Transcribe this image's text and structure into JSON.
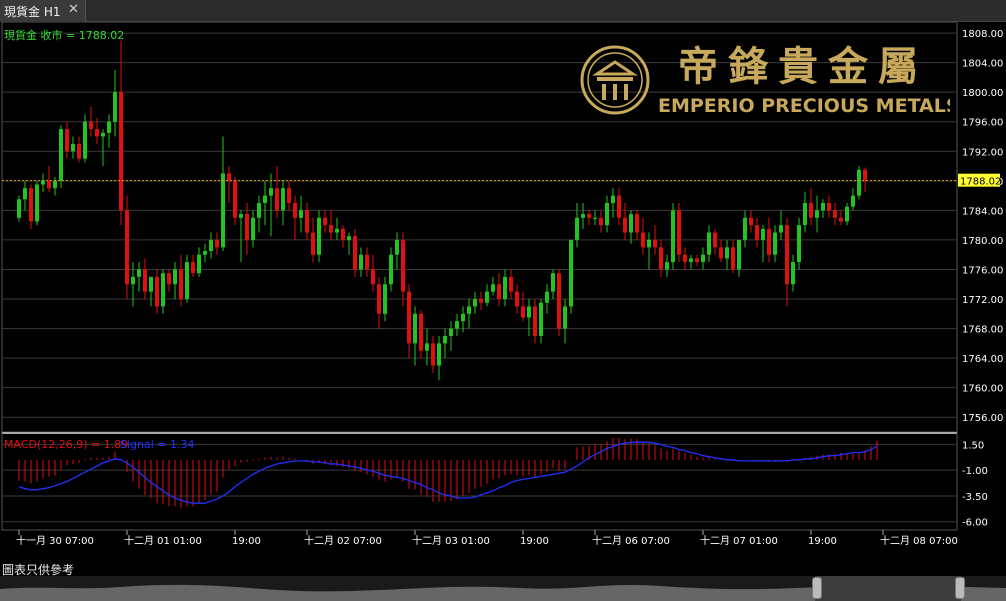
{
  "window": {
    "tab_title": "現貨金 H1",
    "close_glyph": "✕"
  },
  "logo": {
    "chinese_name": "帝鋒貴金屬",
    "english_name": "EMPERIO PRECIOUS METALS",
    "icon": "emperio-emblem-icon",
    "gold_color": "#c8a85a"
  },
  "footer_note": "圖表只供參考",
  "colors": {
    "bull": "#22c422",
    "bear": "#e01010",
    "grid": "#3a3a3a",
    "axis_text": "#ffffff",
    "price_line": "#e8a020",
    "price_label_bg": "#ffff33",
    "legend_main": "#33dd33",
    "macd_hist": "#e01010",
    "macd_signal": "#2030ff",
    "macd_label": "#e01010"
  },
  "chart_data": [
    {
      "type": "candlestick",
      "legend": "現貨金 收市 = 1788.02",
      "current_price": 1788.02,
      "current_price_label": "1788.02",
      "ylim": [
        1754,
        1809.5
      ],
      "y_ticks": [
        1808.0,
        1804.0,
        1800.0,
        1796.0,
        1792.0,
        1788.0,
        1784.0,
        1780.0,
        1776.0,
        1772.0,
        1768.0,
        1764.0,
        1760.0,
        1756.0
      ],
      "y_tick_labels": [
        "1808.00",
        "1804.00",
        "1800.00",
        "1796.00",
        "1792.00",
        "1788.00",
        "1784.00",
        "1780.00",
        "1776.00",
        "1772.00",
        "1768.00",
        "1764.00",
        "1760.00",
        "1756.00"
      ],
      "x_labels": [
        {
          "label": "十一月 30 07:00",
          "index": 0
        },
        {
          "label": "十二月 01 01:00",
          "index": 18
        },
        {
          "label": "19:00",
          "index": 36
        },
        {
          "label": "十二月 02 07:00",
          "index": 48
        },
        {
          "label": "十二月 03 01:00",
          "index": 66
        },
        {
          "label": "19:00",
          "index": 84
        },
        {
          "label": "十二月 06 07:00",
          "index": 96
        },
        {
          "label": "十二月 07 01:00",
          "index": 114
        },
        {
          "label": "19:00",
          "index": 132
        },
        {
          "label": "十二月 08 07:00",
          "index": 144
        }
      ],
      "ohlc": [
        [
          1783.0,
          1786.0,
          1782.5,
          1785.5
        ],
        [
          1785.5,
          1788.0,
          1784.0,
          1787.0
        ],
        [
          1787.0,
          1787.5,
          1781.5,
          1782.5
        ],
        [
          1782.5,
          1788.0,
          1782.0,
          1787.5
        ],
        [
          1787.5,
          1789.0,
          1786.5,
          1788.0
        ],
        [
          1788.0,
          1790.0,
          1786.5,
          1787.0
        ],
        [
          1787.0,
          1788.5,
          1786.0,
          1788.0
        ],
        [
          1788.0,
          1795.5,
          1787.0,
          1795.0
        ],
        [
          1795.0,
          1796.0,
          1791.0,
          1792.0
        ],
        [
          1792.0,
          1794.0,
          1791.0,
          1793.0
        ],
        [
          1793.0,
          1794.0,
          1790.5,
          1791.0
        ],
        [
          1791.0,
          1797.0,
          1790.5,
          1796.0
        ],
        [
          1796.0,
          1798.0,
          1794.0,
          1795.0
        ],
        [
          1795.0,
          1796.5,
          1793.0,
          1794.0
        ],
        [
          1794.0,
          1795.0,
          1790.0,
          1794.5
        ],
        [
          1794.5,
          1797.0,
          1792.5,
          1796.0
        ],
        [
          1796.0,
          1803.0,
          1794.0,
          1800.0
        ],
        [
          1800.0,
          1807.0,
          1782.0,
          1784.0
        ],
        [
          1784.0,
          1786.0,
          1772.0,
          1774.0
        ],
        [
          1774.0,
          1777.0,
          1771.0,
          1775.0
        ],
        [
          1775.0,
          1777.0,
          1773.0,
          1776.0
        ],
        [
          1776.0,
          1777.5,
          1772.0,
          1773.0
        ],
        [
          1773.0,
          1775.0,
          1771.0,
          1775.0
        ],
        [
          1775.0,
          1776.0,
          1770.0,
          1771.0
        ],
        [
          1771.0,
          1776.0,
          1770.0,
          1775.5
        ],
        [
          1775.5,
          1776.0,
          1773.0,
          1774.0
        ],
        [
          1774.0,
          1777.0,
          1772.0,
          1776.0
        ],
        [
          1776.0,
          1778.0,
          1771.0,
          1772.0
        ],
        [
          1772.0,
          1778.0,
          1771.5,
          1777.0
        ],
        [
          1777.0,
          1778.0,
          1775.0,
          1775.5
        ],
        [
          1775.5,
          1779.0,
          1775.0,
          1778.0
        ],
        [
          1778.0,
          1779.5,
          1777.0,
          1778.5
        ],
        [
          1778.5,
          1781.0,
          1777.5,
          1780.0
        ],
        [
          1780.0,
          1781.0,
          1778.0,
          1779.0
        ],
        [
          1779.0,
          1794.0,
          1778.5,
          1789.0
        ],
        [
          1789.0,
          1790.0,
          1785.0,
          1788.0
        ],
        [
          1788.0,
          1788.5,
          1782.0,
          1783.0
        ],
        [
          1783.0,
          1784.0,
          1777.0,
          1783.5
        ],
        [
          1783.5,
          1785.0,
          1778.0,
          1780.0
        ],
        [
          1780.0,
          1784.0,
          1779.0,
          1783.0
        ],
        [
          1783.0,
          1786.0,
          1781.0,
          1785.0
        ],
        [
          1785.0,
          1788.0,
          1782.0,
          1786.0
        ],
        [
          1786.0,
          1789.0,
          1780.5,
          1787.0
        ],
        [
          1787.0,
          1790.0,
          1783.0,
          1784.0
        ],
        [
          1784.0,
          1788.0,
          1782.0,
          1787.0
        ],
        [
          1787.0,
          1788.0,
          1784.0,
          1785.0
        ],
        [
          1785.0,
          1786.0,
          1780.0,
          1783.0
        ],
        [
          1783.0,
          1786.0,
          1781.0,
          1784.0
        ],
        [
          1784.0,
          1785.0,
          1780.0,
          1781.0
        ],
        [
          1781.0,
          1783.0,
          1777.0,
          1778.0
        ],
        [
          1778.0,
          1784.0,
          1777.0,
          1783.0
        ],
        [
          1783.0,
          1784.0,
          1781.0,
          1782.0
        ],
        [
          1782.0,
          1784.0,
          1780.0,
          1781.0
        ],
        [
          1781.0,
          1783.0,
          1780.0,
          1781.5
        ],
        [
          1781.5,
          1782.0,
          1779.0,
          1780.0
        ],
        [
          1780.0,
          1781.0,
          1778.0,
          1780.5
        ],
        [
          1780.5,
          1781.5,
          1775.0,
          1776.0
        ],
        [
          1776.0,
          1779.0,
          1775.0,
          1778.0
        ],
        [
          1778.0,
          1779.0,
          1775.0,
          1776.0
        ],
        [
          1776.0,
          1778.0,
          1773.0,
          1774.0
        ],
        [
          1774.0,
          1775.0,
          1768.0,
          1770.0
        ],
        [
          1770.0,
          1775.0,
          1769.0,
          1774.0
        ],
        [
          1774.0,
          1779.0,
          1773.0,
          1778.0
        ],
        [
          1778.0,
          1781.0,
          1776.0,
          1780.0
        ],
        [
          1780.0,
          1781.0,
          1771.0,
          1773.0
        ],
        [
          1773.0,
          1774.0,
          1764.0,
          1766.0
        ],
        [
          1766.0,
          1771.0,
          1763.0,
          1770.0
        ],
        [
          1770.0,
          1770.5,
          1764.0,
          1765.0
        ],
        [
          1765.0,
          1768.0,
          1763.0,
          1766.0
        ],
        [
          1766.0,
          1767.0,
          1762.0,
          1763.0
        ],
        [
          1763.0,
          1767.0,
          1761.0,
          1766.0
        ],
        [
          1766.0,
          1768.0,
          1764.0,
          1767.0
        ],
        [
          1767.0,
          1769.0,
          1765.0,
          1768.0
        ],
        [
          1768.0,
          1770.0,
          1767.0,
          1769.0
        ],
        [
          1769.0,
          1771.0,
          1767.5,
          1770.0
        ],
        [
          1770.0,
          1772.0,
          1768.0,
          1771.0
        ],
        [
          1771.0,
          1773.0,
          1770.0,
          1772.0
        ],
        [
          1772.0,
          1773.0,
          1770.5,
          1771.5
        ],
        [
          1771.5,
          1774.0,
          1771.0,
          1773.0
        ],
        [
          1773.0,
          1775.0,
          1772.5,
          1774.0
        ],
        [
          1774.0,
          1775.5,
          1771.0,
          1772.0
        ],
        [
          1772.0,
          1776.0,
          1771.0,
          1775.0
        ],
        [
          1775.0,
          1776.0,
          1772.0,
          1773.0
        ],
        [
          1773.0,
          1774.0,
          1770.0,
          1771.0
        ],
        [
          1771.0,
          1773.0,
          1769.0,
          1769.5
        ],
        [
          1769.5,
          1772.0,
          1767.0,
          1771.0
        ],
        [
          1771.0,
          1772.0,
          1766.0,
          1767.0
        ],
        [
          1767.0,
          1772.0,
          1766.0,
          1771.5
        ],
        [
          1771.5,
          1774.0,
          1770.0,
          1773.0
        ],
        [
          1773.0,
          1776.0,
          1772.0,
          1775.5
        ],
        [
          1775.5,
          1776.0,
          1767.0,
          1768.0
        ],
        [
          1768.0,
          1772.0,
          1766.0,
          1771.0
        ],
        [
          1771.0,
          1780.0,
          1770.0,
          1780.0
        ],
        [
          1780.0,
          1785.0,
          1779.0,
          1783.0
        ],
        [
          1783.0,
          1785.0,
          1781.5,
          1783.5
        ],
        [
          1783.5,
          1784.0,
          1782.0,
          1783.0
        ],
        [
          1783.0,
          1784.0,
          1782.0,
          1783.0
        ],
        [
          1783.0,
          1784.0,
          1781.0,
          1782.0
        ],
        [
          1782.0,
          1786.0,
          1781.0,
          1785.0
        ],
        [
          1785.0,
          1787.0,
          1783.0,
          1786.0
        ],
        [
          1786.0,
          1787.0,
          1782.0,
          1783.0
        ],
        [
          1783.0,
          1785.0,
          1780.0,
          1781.0
        ],
        [
          1781.0,
          1784.0,
          1779.5,
          1783.5
        ],
        [
          1783.5,
          1784.0,
          1780.0,
          1781.0
        ],
        [
          1781.0,
          1783.0,
          1778.0,
          1779.0
        ],
        [
          1779.0,
          1781.0,
          1776.0,
          1780.0
        ],
        [
          1780.0,
          1782.0,
          1778.0,
          1779.0
        ],
        [
          1779.0,
          1780.0,
          1775.0,
          1776.0
        ],
        [
          1776.0,
          1778.0,
          1775.0,
          1777.0
        ],
        [
          1777.0,
          1785.0,
          1776.0,
          1784.0
        ],
        [
          1784.0,
          1785.0,
          1777.0,
          1778.0
        ],
        [
          1778.0,
          1779.0,
          1776.0,
          1777.0
        ],
        [
          1777.0,
          1778.0,
          1776.0,
          1777.5
        ],
        [
          1777.5,
          1778.0,
          1776.5,
          1777.0
        ],
        [
          1777.0,
          1779.0,
          1776.0,
          1778.0
        ],
        [
          1778.0,
          1782.0,
          1777.0,
          1781.0
        ],
        [
          1781.0,
          1781.5,
          1778.0,
          1779.0
        ],
        [
          1779.0,
          1780.0,
          1777.0,
          1777.5
        ],
        [
          1777.5,
          1780.0,
          1776.0,
          1779.0
        ],
        [
          1779.0,
          1780.0,
          1775.5,
          1776.0
        ],
        [
          1776.0,
          1780.0,
          1775.0,
          1780.0
        ],
        [
          1780.0,
          1784.0,
          1779.0,
          1783.0
        ],
        [
          1783.0,
          1784.0,
          1781.0,
          1782.0
        ],
        [
          1782.0,
          1783.0,
          1779.0,
          1780.0
        ],
        [
          1780.0,
          1782.0,
          1777.0,
          1781.5
        ],
        [
          1781.5,
          1783.0,
          1777.0,
          1778.0
        ],
        [
          1778.0,
          1782.0,
          1777.0,
          1781.0
        ],
        [
          1781.0,
          1784.0,
          1780.0,
          1782.0
        ],
        [
          1782.0,
          1783.0,
          1771.0,
          1774.0
        ],
        [
          1774.0,
          1778.0,
          1773.0,
          1777.0
        ],
        [
          1777.0,
          1783.0,
          1776.0,
          1782.0
        ],
        [
          1782.0,
          1786.5,
          1781.0,
          1785.0
        ],
        [
          1785.0,
          1787.0,
          1782.0,
          1783.0
        ],
        [
          1783.0,
          1786.0,
          1781.0,
          1784.0
        ],
        [
          1784.0,
          1785.5,
          1783.0,
          1785.0
        ],
        [
          1785.0,
          1786.0,
          1783.0,
          1784.0
        ],
        [
          1784.0,
          1785.0,
          1782.0,
          1783.0
        ],
        [
          1783.0,
          1784.0,
          1782.0,
          1782.5
        ],
        [
          1782.5,
          1785.0,
          1782.0,
          1784.5
        ],
        [
          1784.5,
          1787.0,
          1784.0,
          1786.0
        ],
        [
          1786.0,
          1790.0,
          1785.5,
          1789.5
        ],
        [
          1789.5,
          1789.8,
          1786.5,
          1788.02
        ]
      ]
    },
    {
      "type": "bar",
      "legend_macd": "MACD(12,26,9) = 1.89",
      "legend_signal": "Signal = 1.34",
      "macd_value": 1.89,
      "signal_value": 1.34,
      "ylim": [
        -6.8,
        2.6
      ],
      "y_ticks": [
        1.5,
        -1.0,
        -3.5,
        -6.0
      ],
      "y_tick_labels": [
        "1.50",
        "-1.00",
        "-3.50",
        "-6.00"
      ],
      "macd": [
        -2.0,
        -2.1,
        -2.3,
        -2.1,
        -1.8,
        -1.6,
        -1.5,
        -0.9,
        -0.5,
        -0.4,
        -0.3,
        0.1,
        0.2,
        0.2,
        0.2,
        0.3,
        0.8,
        0.1,
        -1.2,
        -2.1,
        -2.8,
        -3.4,
        -3.7,
        -4.2,
        -4.3,
        -4.5,
        -4.5,
        -4.7,
        -4.5,
        -4.5,
        -4.2,
        -3.9,
        -3.4,
        -3.1,
        -1.7,
        -0.9,
        -0.6,
        -0.3,
        -0.2,
        -0.1,
        0.1,
        0.2,
        0.3,
        0.2,
        0.3,
        0.2,
        0.1,
        0.0,
        -0.2,
        -0.4,
        -0.3,
        -0.4,
        -0.5,
        -0.6,
        -0.7,
        -0.8,
        -1.1,
        -1.2,
        -1.4,
        -1.6,
        -2.0,
        -2.1,
        -1.9,
        -1.7,
        -2.1,
        -2.8,
        -2.9,
        -3.4,
        -3.6,
        -4.1,
        -4.1,
        -4.1,
        -4.0,
        -3.8,
        -3.5,
        -3.2,
        -2.8,
        -2.6,
        -2.3,
        -1.9,
        -1.8,
        -1.5,
        -1.4,
        -1.5,
        -1.6,
        -1.5,
        -1.7,
        -1.4,
        -1.2,
        -0.8,
        -1.1,
        -0.9,
        0.0,
        1.2,
        1.3,
        1.4,
        1.5,
        1.5,
        1.8,
        2.1,
        2.1,
        2.0,
        2.1,
        2.0,
        1.8,
        1.6,
        1.4,
        1.1,
        0.9,
        1.1,
        0.9,
        0.7,
        0.5,
        0.3,
        0.2,
        0.3,
        0.2,
        0.1,
        0.0,
        -0.1,
        -0.1,
        0.0,
        0.0,
        -0.1,
        -0.1,
        -0.2,
        -0.2,
        -0.1,
        -0.2,
        0.1,
        0.1,
        0.2,
        0.3,
        0.4,
        0.5,
        0.5,
        0.6,
        0.7,
        0.6,
        0.6,
        0.7,
        0.9,
        1.3,
        1.89
      ],
      "signal": [
        -2.6,
        -2.8,
        -2.9,
        -2.9,
        -2.8,
        -2.7,
        -2.5,
        -2.3,
        -2.1,
        -1.8,
        -1.5,
        -1.2,
        -0.9,
        -0.6,
        -0.3,
        -0.1,
        0.1,
        0.0,
        -0.3,
        -0.7,
        -1.2,
        -1.7,
        -2.2,
        -2.6,
        -3.0,
        -3.4,
        -3.7,
        -3.9,
        -4.1,
        -4.2,
        -4.2,
        -4.2,
        -4.0,
        -3.8,
        -3.5,
        -3.1,
        -2.6,
        -2.2,
        -1.8,
        -1.4,
        -1.1,
        -0.8,
        -0.6,
        -0.4,
        -0.3,
        -0.2,
        -0.1,
        -0.1,
        -0.1,
        -0.2,
        -0.2,
        -0.3,
        -0.4,
        -0.4,
        -0.5,
        -0.6,
        -0.7,
        -0.8,
        -1.0,
        -1.1,
        -1.3,
        -1.5,
        -1.6,
        -1.7,
        -1.8,
        -2.0,
        -2.2,
        -2.4,
        -2.7,
        -2.9,
        -3.2,
        -3.4,
        -3.5,
        -3.7,
        -3.7,
        -3.7,
        -3.6,
        -3.4,
        -3.2,
        -3.0,
        -2.7,
        -2.5,
        -2.2,
        -2.0,
        -1.9,
        -1.8,
        -1.7,
        -1.6,
        -1.5,
        -1.4,
        -1.3,
        -1.2,
        -0.9,
        -0.6,
        -0.2,
        0.2,
        0.5,
        0.8,
        1.1,
        1.3,
        1.5,
        1.6,
        1.7,
        1.7,
        1.7,
        1.7,
        1.6,
        1.5,
        1.3,
        1.2,
        1.0,
        0.9,
        0.7,
        0.6,
        0.4,
        0.3,
        0.2,
        0.1,
        0.0,
        0.0,
        -0.1,
        -0.1,
        -0.1,
        -0.1,
        -0.1,
        -0.1,
        -0.1,
        -0.1,
        -0.1,
        0.0,
        0.0,
        0.1,
        0.1,
        0.2,
        0.3,
        0.4,
        0.4,
        0.5,
        0.6,
        0.7,
        0.7,
        0.8,
        1.0,
        1.34
      ]
    }
  ]
}
